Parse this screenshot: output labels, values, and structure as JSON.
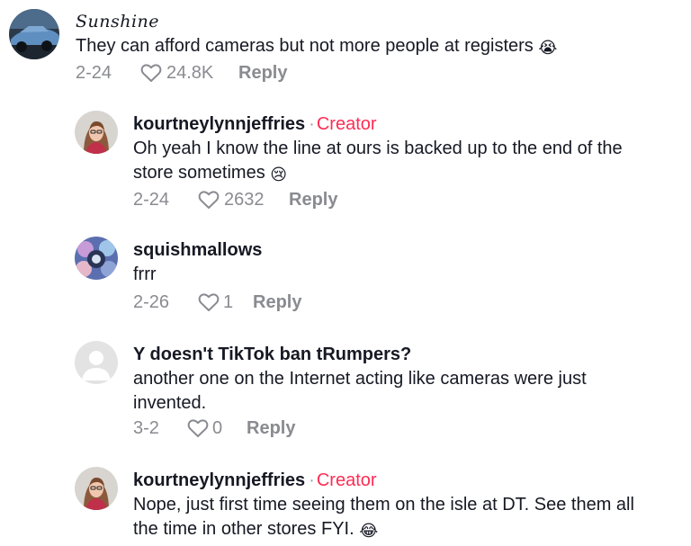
{
  "comments": [
    {
      "author": "Sunshine",
      "text": "They can afford cameras but not more people at registers",
      "emoji": "😭",
      "date": "2-24",
      "likes": "24.8K",
      "reply_label": "Reply"
    },
    {
      "author": "kourtneylynnjeffries",
      "separator": "·",
      "badge": "Creator",
      "text_line1": "Oh yeah I know the line at ours is backed up to the end of the",
      "text_line2": "store sometimes",
      "emoji": "😢",
      "date": "2-24",
      "likes": "2632",
      "reply_label": "Reply"
    },
    {
      "author": "squishmallows",
      "text": "frrr",
      "date": "2-26",
      "likes": "1",
      "reply_label": "Reply"
    },
    {
      "author": "Y doesn't TikTok ban tRumpers?",
      "text_line1": "another one on the Internet acting like cameras were just",
      "text_line2": "invented.",
      "date": "3-2",
      "likes": "0",
      "reply_label": "Reply"
    },
    {
      "author": "kourtneylynnjeffries",
      "separator": "·",
      "badge": "Creator",
      "text_line1": "Nope, just first time seeing them on the isle at DT. See them all",
      "text_line2": "the time in other stores FYI.",
      "emoji": "😂"
    }
  ],
  "colors": {
    "creator_badge": "#fe2c55",
    "meta_text": "#8a8b91",
    "primary_text": "#161823"
  },
  "icons": {
    "like": "heart-outline-icon"
  }
}
